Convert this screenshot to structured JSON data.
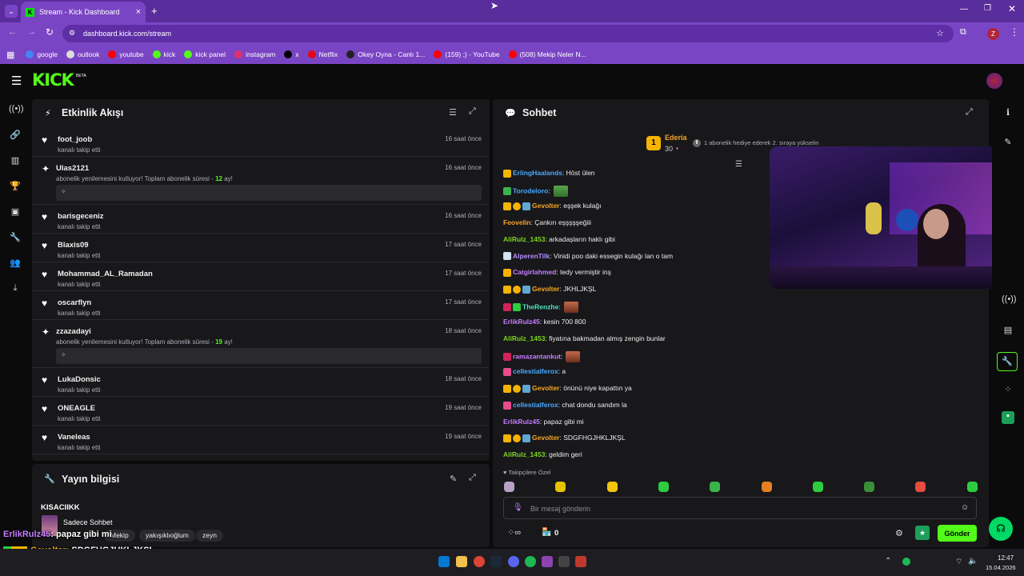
{
  "browser": {
    "tab_title": "Stream - Kick Dashboard",
    "url": "dashboard.kick.com/stream",
    "bookmarks": [
      {
        "label": "google",
        "color": "#4285f4"
      },
      {
        "label": "outlook",
        "color": "#dddddd"
      },
      {
        "label": "youtube",
        "color": "#ff0000"
      },
      {
        "label": "kick",
        "color": "#53fc18"
      },
      {
        "label": "kick panel",
        "color": "#53fc18"
      },
      {
        "label": "instagram",
        "color": "#e1306c"
      },
      {
        "label": "x",
        "color": "#000000"
      },
      {
        "label": "Netflix",
        "color": "#e50914"
      },
      {
        "label": "Okey Oyna - Canlı 1...",
        "color": "#222222"
      },
      {
        "label": "(159) ;) - YouTube",
        "color": "#ff0000"
      },
      {
        "label": "(508) Mekip Neler N...",
        "color": "#ff0000"
      }
    ],
    "profile_initial": "Z"
  },
  "app": {
    "logo": "KICK",
    "beta": "BETA",
    "accent": "#53fc18"
  },
  "activity": {
    "title": "Etkinlik Akışı",
    "items": [
      {
        "type": "follow",
        "name": "foot_joob",
        "sub": "kanalı takip etti",
        "time": "16 saat önce"
      },
      {
        "type": "resub",
        "name": "Ulas2121",
        "sub_pre": "abonelik yenilemesini kutluyor! Toplam abonelik süresi - ",
        "months": "12",
        "sub_post": " ay!",
        "time": "16 saat önce"
      },
      {
        "type": "follow",
        "name": "barisgeceniz",
        "sub": "kanalı takip etti",
        "time": "16 saat önce"
      },
      {
        "type": "follow",
        "name": "Blaxis09",
        "sub": "kanalı takip etti",
        "time": "17 saat önce"
      },
      {
        "type": "follow",
        "name": "Mohammad_AL_Ramadan",
        "sub": "kanalı takip etti",
        "time": "17 saat önce"
      },
      {
        "type": "follow",
        "name": "oscarflyn",
        "sub": "kanalı takip etti",
        "time": "17 saat önce"
      },
      {
        "type": "resub",
        "name": "zzazadayi",
        "sub_pre": "abonelik yenilemesini kutluyor! Toplam abonelik süresi - ",
        "months": "19",
        "sub_post": " ay!",
        "time": "18 saat önce"
      },
      {
        "type": "follow",
        "name": "LukaDonsic",
        "sub": "kanalı takip etti",
        "time": "18 saat önce"
      },
      {
        "type": "follow",
        "name": "ONEAGLE",
        "sub": "kanalı takip etti",
        "time": "19 saat önce"
      },
      {
        "type": "follow",
        "name": "Vaneleas",
        "sub": "kanalı takip etti",
        "time": "19 saat önce"
      }
    ]
  },
  "stream_info": {
    "title": "Yayın bilgisi",
    "stream_title": "KISACIIKK",
    "category": "Sadece Sohbet",
    "tags": [
      "Mekip",
      "yakışıklıoğlum",
      "zeyn"
    ]
  },
  "chat": {
    "title": "Sohbet",
    "top_gifter": {
      "rank": "1",
      "name": "Ederia",
      "count": "30"
    },
    "gift_hint": "1 abonelik hediye ederek 2. sıraya yükselin",
    "messages": [
      {
        "user": "ErlingHaalands",
        "color": "#4aa8ff",
        "text": ": Höst ülen",
        "badges": [
          "crown"
        ]
      },
      {
        "user": "Torodeloro",
        "color": "#4aa8ff",
        "text": ":",
        "badges": [
          "frog"
        ],
        "emote": true
      },
      {
        "user": "Gevolter",
        "color": "#f5a623",
        "text": ": eşşek kulağı",
        "badges": [
          "crown",
          "one",
          "gift"
        ]
      },
      {
        "user": "Feovelin",
        "color": "#f5a623",
        "text": ": Çankırı eşşşşşeğiii",
        "badges": []
      },
      {
        "user": "AliRulz_1453",
        "color": "#7ed321",
        "text": ": arkadaşların haklı gibi",
        "badges": []
      },
      {
        "user": "AlperenTilk",
        "color": "#b48bff",
        "text": ": Vinidi poo daki essegin kulağı lan o tam",
        "badges": [
          "cat"
        ]
      },
      {
        "user": "Catgirlahmed",
        "color": "#c77dff",
        "text": ": tedy vermiştir inş",
        "badges": [
          "crown"
        ]
      },
      {
        "user": "Gevolter",
        "color": "#f5a623",
        "text": ": JKHLJKŞL",
        "badges": [
          "crown",
          "one",
          "gift"
        ]
      },
      {
        "user": "TheRenzhe",
        "color": "#50e3c2",
        "text": ":",
        "badges": [
          "devil",
          "green"
        ],
        "emote": true
      },
      {
        "user": "ErlikRulz45",
        "color": "#c77dff",
        "text": ": kesin 700 800",
        "badges": []
      },
      {
        "user": "AliRulz_1453",
        "color": "#7ed321",
        "text": ": fiyatına bakmadan almış zengin bunlar",
        "badges": []
      },
      {
        "user": "ramazantankut",
        "color": "#c77dff",
        "text": ":",
        "badges": [
          "devil"
        ],
        "emote": true
      },
      {
        "user": "cellestialferox",
        "color": "#4aa8ff",
        "text": ": a",
        "badges": [
          "heart"
        ]
      },
      {
        "user": "Gevolter",
        "color": "#f5a623",
        "text": ": önünü niye kapattın ya",
        "badges": [
          "crown",
          "one",
          "gift"
        ]
      },
      {
        "user": "cellestialferox",
        "color": "#4aa8ff",
        "text": ": chat dondu sandım la",
        "badges": [
          "heart"
        ]
      },
      {
        "user": "ErlikRulz45",
        "color": "#c77dff",
        "text": ": papaz gibi mi",
        "badges": []
      },
      {
        "user": "Gevolter",
        "color": "#f5a623",
        "text": ": SDGFHGJHKLJKŞL",
        "badges": [
          "crown",
          "one",
          "gift"
        ]
      },
      {
        "user": "AliRulz_1453",
        "color": "#7ed321",
        "text": ": geldim geri",
        "badges": []
      }
    ],
    "followers_only": "Takipçilere Özel",
    "input_placeholder": "Bir mesaj gönderin",
    "points": "0",
    "send_label": "Gönder"
  },
  "overlay": {
    "lines": [
      {
        "user": "ErlikRulz45",
        "text": ": papaz gibi mi",
        "color": "#c77dff"
      },
      {
        "user": "Gevolter",
        "text": ": SDGFHGJHKLJKŞL",
        "color": "#f5a623"
      },
      {
        "user": "AliRulz_1453",
        "text": ": geldim geri",
        "color": "#7ed321"
      }
    ]
  },
  "taskbar": {
    "time": "12:47",
    "date": "15.04.2026"
  }
}
